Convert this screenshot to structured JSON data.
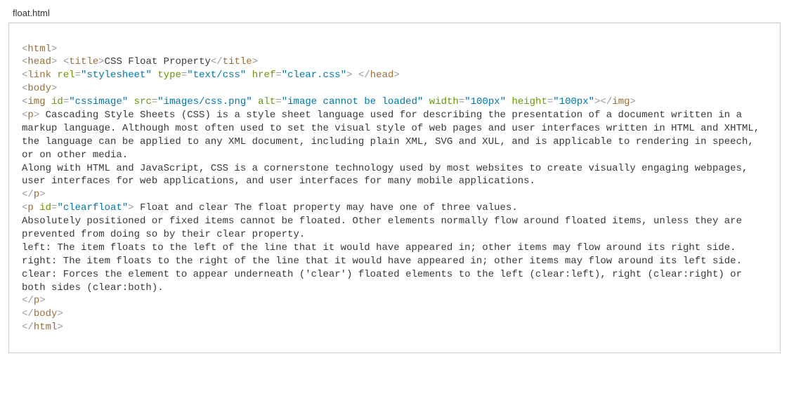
{
  "filename": "float.html",
  "code": {
    "line1_html": "html",
    "line2_head": "head",
    "line2_title": "title",
    "line2_titletext": "CSS Float Property",
    "line3_link": "link",
    "line3_rel_attr": "rel",
    "line3_rel_val": "\"stylesheet\"",
    "line3_type_attr": "type",
    "line3_type_val": "\"text/css\"",
    "line3_href_attr": "href",
    "line3_href_val": "\"clear.css\"",
    "line4_body": "body",
    "line5_img": "img",
    "line5_id_attr": "id",
    "line5_id_val": "\"cssimage\"",
    "line5_src_attr": "src",
    "line5_src_val": "\"images/css.png\"",
    "line5_alt_attr": "alt",
    "line5_alt_val": "\"image cannot be loaded\"",
    "line5_width_attr": "width",
    "line5_width_val": "\"100px\"",
    "line5_height_attr": "height",
    "line5_height_val": "\"100px\"",
    "p": "p",
    "para1_text": " Cascading Style Sheets (CSS) is a style sheet language used for describing the presentation of a document written in a markup language. Although most often used to set the visual style of web pages and user interfaces written in HTML and XHTML, the language can be applied to any XML document, including plain XML, SVG and XUL, and is applicable to rendering in speech, or on other media.\nAlong with HTML and JavaScript, CSS is a cornerstone technology used by most websites to create visually engaging webpages, user interfaces for web applications, and user interfaces for many mobile applications.\n",
    "para2_id_attr": "id",
    "para2_id_val": "\"clearfloat\"",
    "para2_text": " Float and clear The float property may have one of three values.\nAbsolutely positioned or fixed items cannot be floated. Other elements normally flow around floated items, unless they are prevented from doing so by their clear property.\nleft: The item floats to the left of the line that it would have appeared in; other items may flow around its right side.\nright: The item floats to the right of the line that it would have appeared in; other items may flow around its left side.\nclear: Forces the element to appear underneath ('clear') floated elements to the left (clear:left), right (clear:right) or both sides (clear:both).\n"
  }
}
